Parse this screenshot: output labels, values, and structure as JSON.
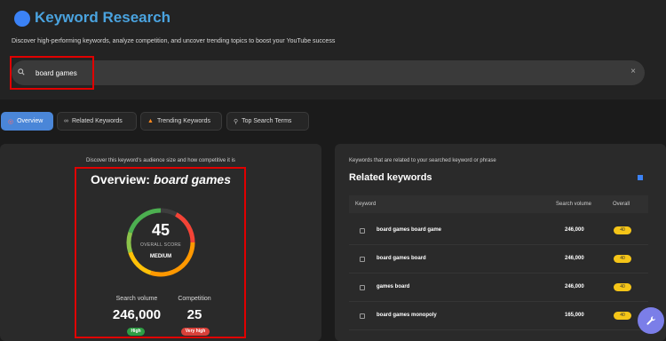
{
  "header": {
    "title": "Keyword Research",
    "subtitle": "Discover high-performing keywords, analyze competition, and uncover trending topics to boost your YouTube success"
  },
  "search": {
    "value": "board games",
    "clear_label": "×"
  },
  "tabs": [
    {
      "label": "Overview",
      "icon": "target-icon",
      "active": true
    },
    {
      "label": "Related Keywords",
      "icon": "link-icon",
      "active": false
    },
    {
      "label": "Trending Keywords",
      "icon": "fire-icon",
      "active": false
    },
    {
      "label": "Top Search Terms",
      "icon": "search-icon",
      "active": false
    }
  ],
  "overview": {
    "description": "Discover this keyword's audience size and how competitive it is",
    "title_prefix": "Overview: ",
    "title_keyword": "board games",
    "score": "45",
    "score_fraction": 0.45,
    "score_label": "OVERALL SCORE",
    "score_level": "MEDIUM",
    "search_volume_label": "Search volume",
    "search_volume": "246,000",
    "search_volume_badge": "High",
    "competition_label": "Competition",
    "competition": "25",
    "competition_badge": "Very high"
  },
  "related": {
    "description": "Keywords that are related to your searched keyword or phrase",
    "title": "Related keywords",
    "columns": {
      "keyword": "Keyword",
      "volume": "Search volume",
      "overall": "Overall"
    },
    "rows": [
      {
        "keyword": "board games board game",
        "volume": "246,000",
        "overall": "40"
      },
      {
        "keyword": "board games board",
        "volume": "246,000",
        "overall": "40"
      },
      {
        "keyword": "games board",
        "volume": "246,000",
        "overall": "40"
      },
      {
        "keyword": "board games monopoly",
        "volume": "165,000",
        "overall": "40"
      }
    ]
  },
  "colors": {
    "accent": "#4a86d8",
    "high": "#2e9e44",
    "very_high": "#d9413a",
    "badge": "#f5c518",
    "fab": "#7b7ee8"
  },
  "icons": {
    "fab": "wrench-icon",
    "clear": "close-icon"
  }
}
